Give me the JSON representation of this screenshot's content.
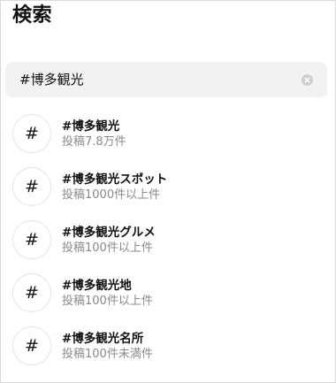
{
  "page": {
    "title": "検索"
  },
  "search": {
    "value": "#博多観光",
    "clear_icon": "clear-icon"
  },
  "results": [
    {
      "icon": "hash-icon",
      "hash_symbol": "#",
      "tag": "#博多観光",
      "count": "投稿7.8万件"
    },
    {
      "icon": "hash-icon",
      "hash_symbol": "#",
      "tag": "#博多観光スポット",
      "count": "投稿1000件以上件"
    },
    {
      "icon": "hash-icon",
      "hash_symbol": "#",
      "tag": "#博多観光グルメ",
      "count": "投稿100件以上件"
    },
    {
      "icon": "hash-icon",
      "hash_symbol": "#",
      "tag": "#博多観光地",
      "count": "投稿100件以上件"
    },
    {
      "icon": "hash-icon",
      "hash_symbol": "#",
      "tag": "#博多観光名所",
      "count": "投稿100件未満件"
    }
  ],
  "colors": {
    "background": "#ffffff",
    "search_bg": "#f2f2f2",
    "secondary_text": "#8a8a8a",
    "primary_text": "#111111"
  }
}
